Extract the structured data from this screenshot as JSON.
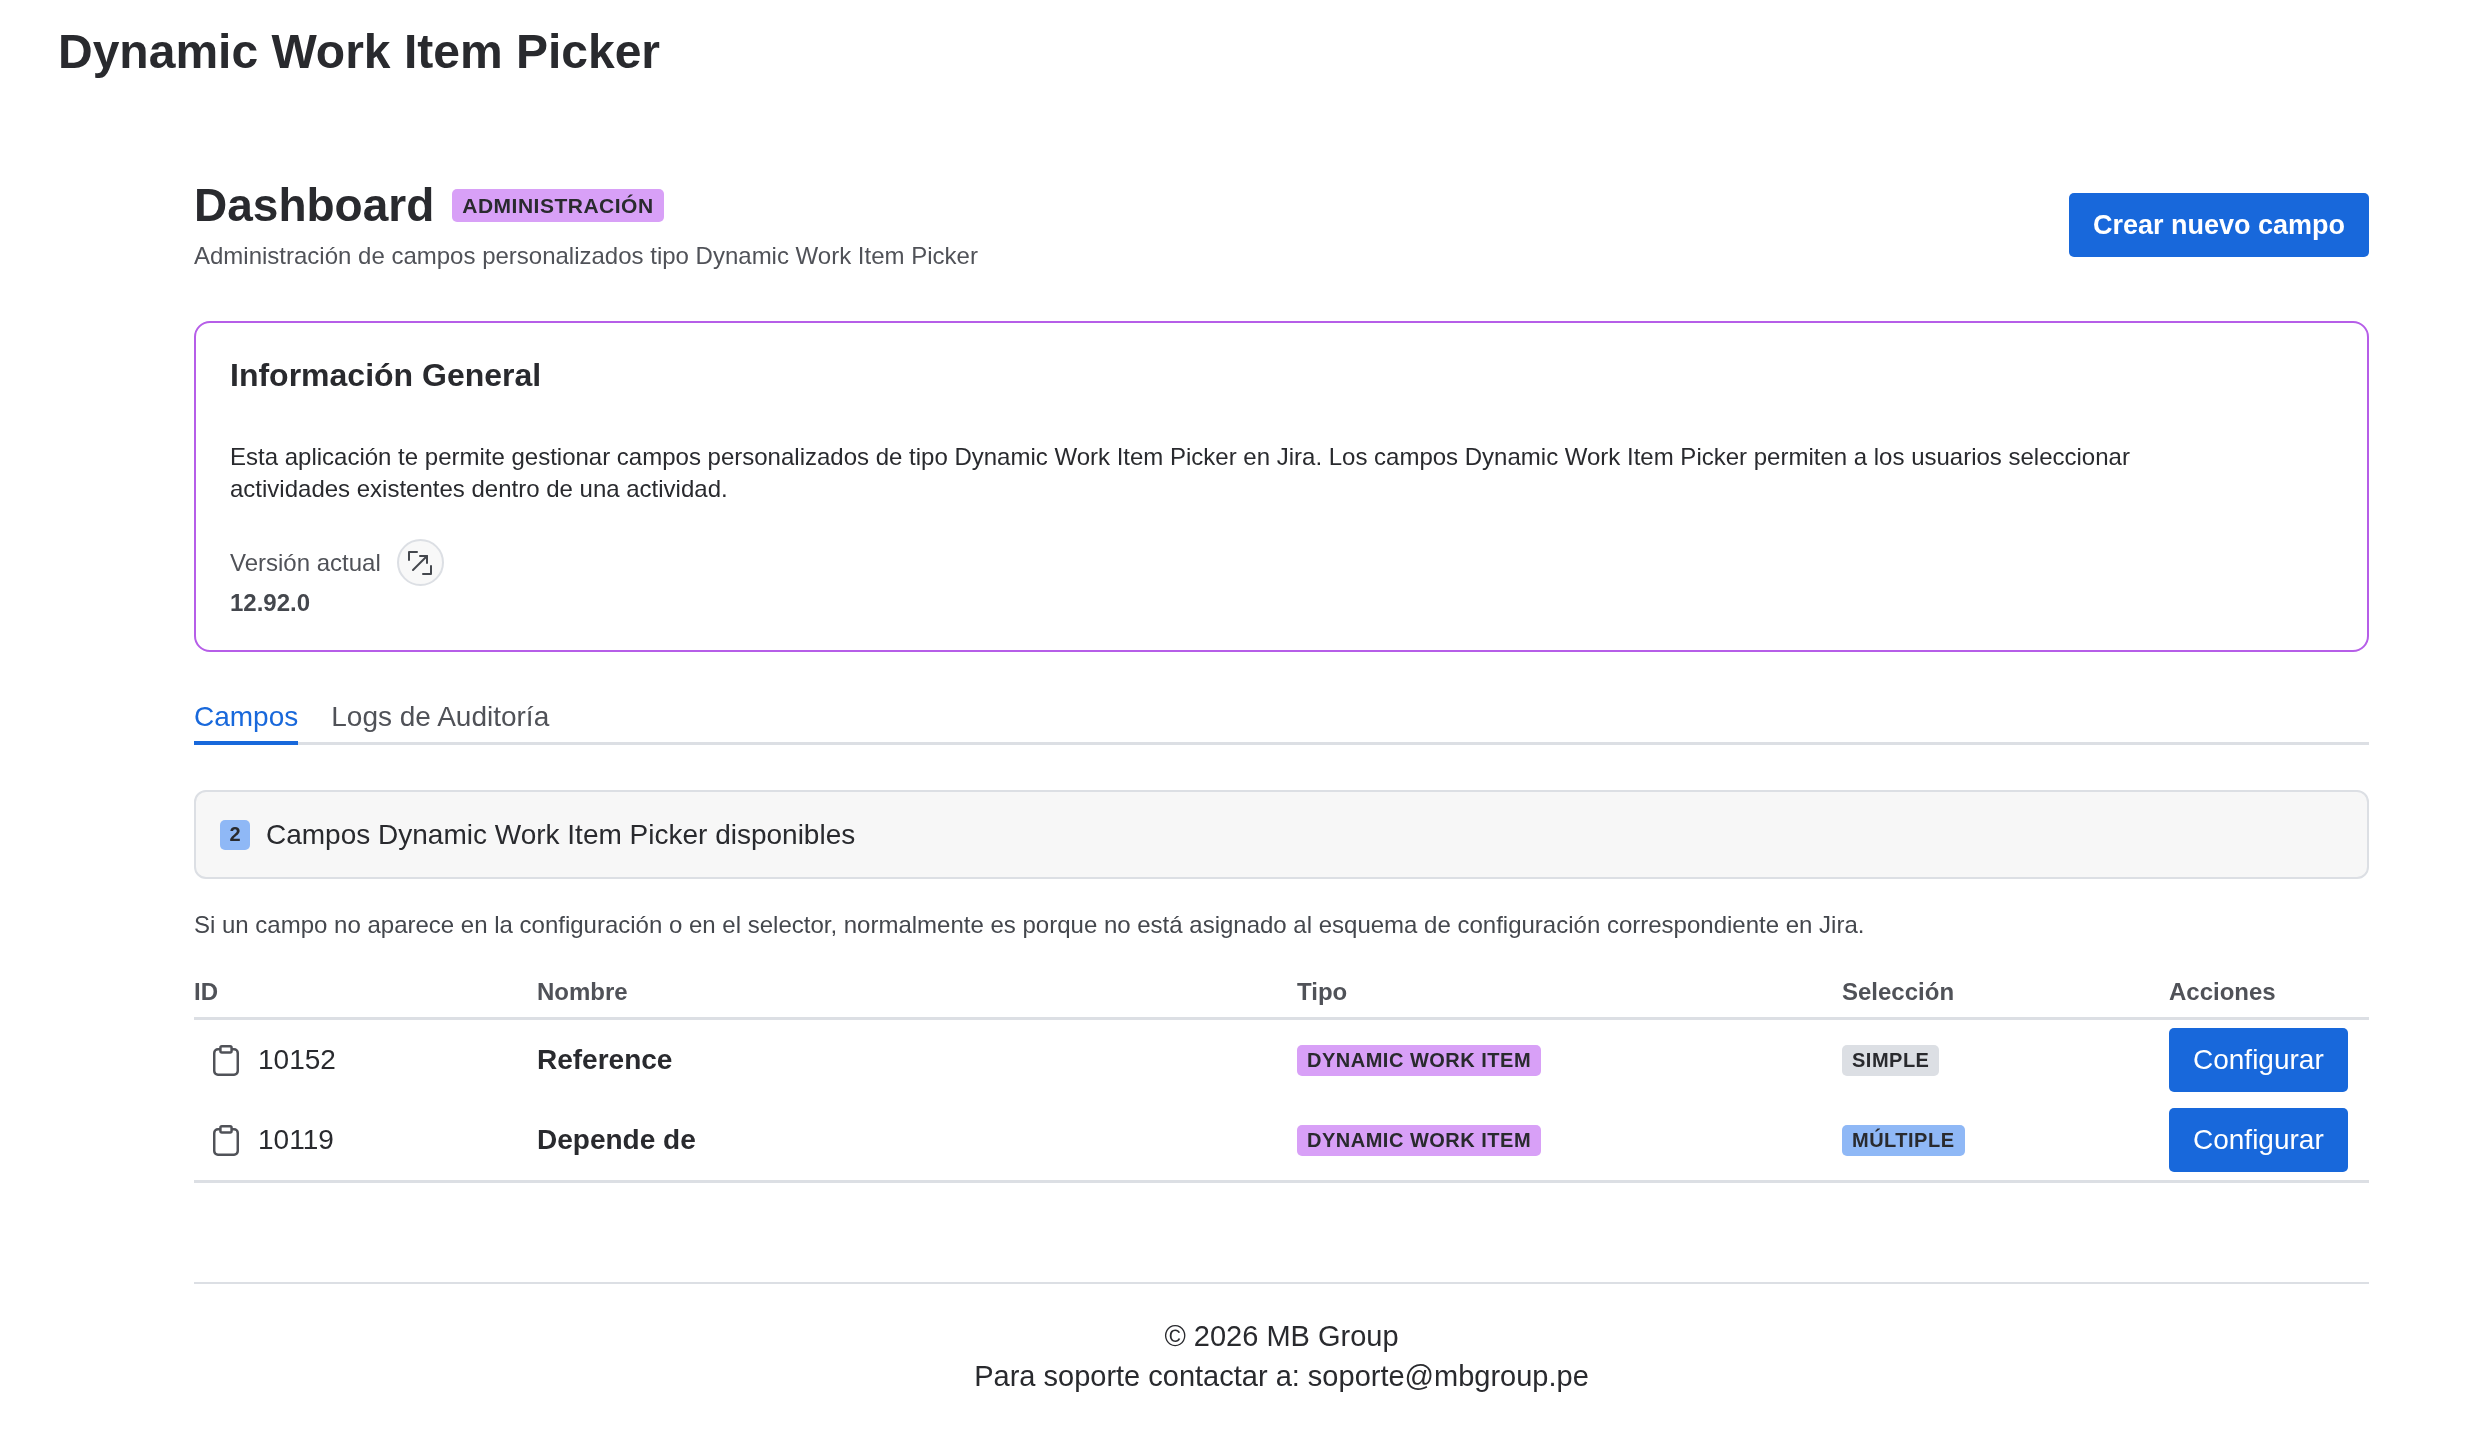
{
  "app_title": "Dynamic Work Item Picker",
  "header": {
    "title": "Dashboard",
    "badge": "ADMINISTRACIÓN",
    "subtitle": "Administración de campos personalizados tipo Dynamic Work Item Picker",
    "create_button": "Crear nuevo campo"
  },
  "info_card": {
    "title": "Información General",
    "description": "Esta aplicación te permite gestionar campos personalizados de tipo Dynamic Work Item Picker en Jira. Los campos Dynamic Work Item Picker permiten a los usuarios seleccionar actividades existentes dentro de una actividad.",
    "version_label": "Versión actual",
    "version": "12.92.0"
  },
  "tabs": [
    {
      "label": "Campos",
      "selected": true
    },
    {
      "label": "Logs de Auditoría",
      "selected": false
    }
  ],
  "fields_summary": {
    "count": "2",
    "title": "Campos Dynamic Work Item Picker disponibles"
  },
  "note": "Si un campo no aparece en la configuración o en el selector, normalmente es porque no está asignado al esquema de configuración correspondiente en Jira.",
  "table": {
    "columns": [
      "ID",
      "Nombre",
      "Tipo",
      "Selección",
      "Acciones"
    ],
    "rows": [
      {
        "id": "10152",
        "name": "Reference",
        "type": "DYNAMIC WORK ITEM",
        "selection": {
          "label": "SIMPLE",
          "color": "#dcdfe4"
        },
        "action": "Configurar"
      },
      {
        "id": "10119",
        "name": "Depende de",
        "type": "DYNAMIC WORK ITEM",
        "selection": {
          "label": "MÚLTIPLE",
          "color": "#8fb8f6"
        },
        "action": "Configurar"
      }
    ]
  },
  "footer": {
    "copyright": "© 2026 MB Group",
    "support": "Para soporte contactar a: soporte@mbgroup.pe"
  }
}
